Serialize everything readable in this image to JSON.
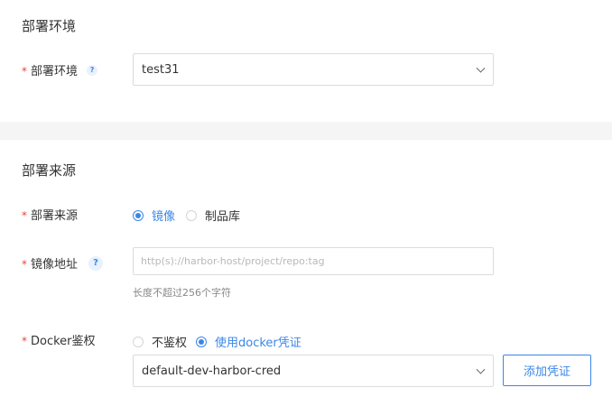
{
  "env_section": {
    "title": "部署环境",
    "field_label": "部署环境",
    "required_mark": "*",
    "help_icon": "?",
    "select_value": "test31"
  },
  "source_section": {
    "title": "部署来源",
    "source_field": {
      "label": "部署来源",
      "required_mark": "*",
      "options": [
        "镜像",
        "制品库"
      ],
      "selected": "镜像"
    },
    "image_field": {
      "label": "镜像地址",
      "required_mark": "*",
      "help_icon": "?",
      "placeholder": "http(s)://harbor-host/project/repo:tag",
      "value": "",
      "hint": "长度不超过256个字符"
    },
    "docker_auth_field": {
      "label": "Docker鉴权",
      "required_mark": "*",
      "options": [
        "不鉴权",
        "使用docker凭证"
      ],
      "selected": "使用docker凭证",
      "credential_value": "default-dev-harbor-cred",
      "add_button_label": "添加凭证"
    }
  },
  "colors": {
    "accent": "#3a86e7",
    "required": "#e8453c",
    "background": "#f5f5f5"
  }
}
